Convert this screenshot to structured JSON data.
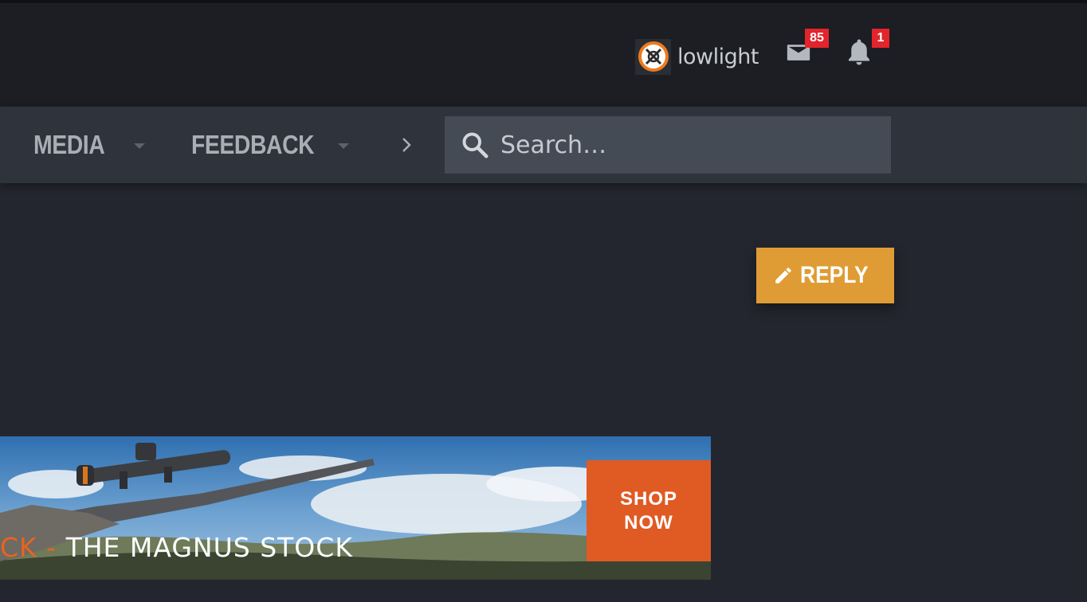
{
  "header": {
    "username": "lowlight",
    "messages_badge": "85",
    "alerts_badge": "1"
  },
  "nav": {
    "items": [
      {
        "label": "MEDIA"
      },
      {
        "label": "FEEDBACK"
      }
    ],
    "search_placeholder": "Search…"
  },
  "thread": {
    "reply_label": "REPLY"
  },
  "banner": {
    "prefix": "CK - ",
    "headline": "THE MAGNUS STOCK",
    "cta_line1": "SHOP",
    "cta_line2": "NOW"
  },
  "colors": {
    "page_bg": "#24262f",
    "header_bg": "#1c1e24",
    "nav_bg": "#2e333c",
    "search_bg": "#444b55",
    "reply_accent": "#df9c35",
    "badge_red": "#e3252b",
    "ad_orange": "#e05a24"
  },
  "icons": {
    "avatar": "crossed-arrows-circle-avatar",
    "messages": "envelope-icon",
    "alerts": "bell-icon",
    "nav_more": "chevron-right-icon",
    "search": "magnifier-icon",
    "reply": "pencil-icon"
  }
}
